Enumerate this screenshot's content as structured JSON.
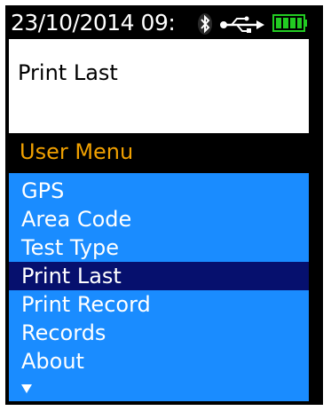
{
  "status_bar": {
    "datetime": "23/10/2014 09:",
    "icons": [
      "bluetooth-icon",
      "usb-icon",
      "battery-full-icon"
    ]
  },
  "current_selection": "Print Last",
  "menu": {
    "title": "User Menu",
    "items": [
      {
        "label": "GPS"
      },
      {
        "label": "Area Code"
      },
      {
        "label": "Test Type"
      },
      {
        "label": "Print Last",
        "selected": true
      },
      {
        "label": "Print Record"
      },
      {
        "label": "Records"
      },
      {
        "label": "About"
      }
    ],
    "more_indicator_icon": "scroll-down-arrow-icon"
  },
  "colors": {
    "menu_background": "#1a8cff",
    "menu_highlight": "#06106e",
    "menu_title_text": "#f0a000",
    "battery": "#22cc22"
  }
}
